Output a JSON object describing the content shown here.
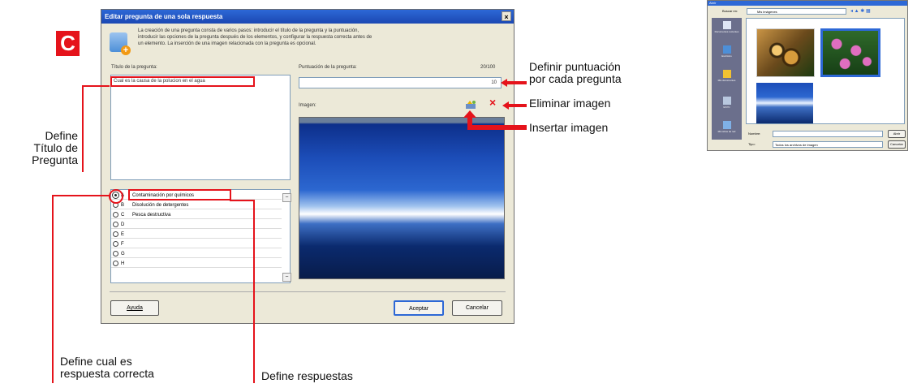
{
  "logo_letter": "C",
  "dialog": {
    "title": "Editar pregunta de una sola respuesta",
    "close_glyph": "×",
    "intro_lines": [
      "La creación de una pregunta consta de varios pasos: introducir el título de la pregunta y la puntuación,",
      "introducir las opciones de la pregunta después de los elementos, y configurar la respuesta correcta antes de",
      "un elemento. La inserción de una imagen relacionada con la pregunta es opcional."
    ],
    "question_title_label": "Título de la pregunta:",
    "question_title_value": "Cual es la causa de la polucion en el agua",
    "score_label": "Puntuación de la pregunta:",
    "score_total": "20/100",
    "score_value": "10",
    "image_label": "Imagen:",
    "answers": [
      {
        "letter": "A",
        "text": "Contaminación por químicos",
        "selected": true
      },
      {
        "letter": "B",
        "text": "Disolución de detergentes",
        "selected": false
      },
      {
        "letter": "C",
        "text": "Pesca destructiva",
        "selected": false
      },
      {
        "letter": "D",
        "text": "",
        "selected": false
      },
      {
        "letter": "E",
        "text": "",
        "selected": false
      },
      {
        "letter": "F",
        "text": "",
        "selected": false
      },
      {
        "letter": "G",
        "text": "",
        "selected": false
      },
      {
        "letter": "H",
        "text": "",
        "selected": false
      }
    ],
    "help_button": "Ayuda",
    "accept_button": "Aceptar",
    "cancel_button": "Cancelar"
  },
  "annotations": {
    "define_title": [
      "Define",
      "Título de",
      "Pregunta"
    ],
    "define_score": [
      "Definir puntuación",
      "por cada pregunta"
    ],
    "remove_image": "Eliminar imagen",
    "insert_image": "Insertar imagen",
    "correct_answer": [
      "Define cual es",
      "respuesta correcta"
    ],
    "define_answers": "Define respuestas"
  },
  "file_dialog": {
    "title": "Abrir",
    "look_in_label": "Buscar en:",
    "look_in_value": "Mis imágenes",
    "places": [
      "Documentos recientes",
      "Escritorio",
      "Mis documentos",
      "Mi PC",
      "Mis sitios de red"
    ],
    "filename_label": "Nombre:",
    "filetype_label": "Tipo:",
    "filetype_value": "Todos los archivos de imagen",
    "open_button": "Abrir",
    "cancel_button": "Cancelar"
  },
  "colors": {
    "accent_red": "#e5131b",
    "title_blue": "#1c48b3"
  }
}
